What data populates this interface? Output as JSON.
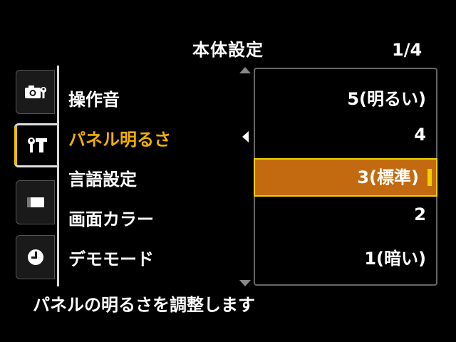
{
  "header": {
    "title": "本体設定",
    "page": "1/4"
  },
  "tabs": [
    {
      "icon": "camera-wrench-icon",
      "active": false
    },
    {
      "icon": "setup-wrench-icon",
      "active": true
    },
    {
      "icon": "card-icon",
      "active": false
    },
    {
      "icon": "clock-icon",
      "active": false
    }
  ],
  "menu": {
    "items": [
      {
        "label": "操作音"
      },
      {
        "label": "パネル明るさ"
      },
      {
        "label": "言語設定"
      },
      {
        "label": "画面カラー"
      },
      {
        "label": "デモモード"
      }
    ],
    "active_index": 1
  },
  "options": {
    "items": [
      {
        "label": "5(明るい)"
      },
      {
        "label": "4"
      },
      {
        "label": "3(標準)"
      },
      {
        "label": "2"
      },
      {
        "label": "1(暗い)"
      }
    ],
    "selected_index": 2
  },
  "colors": {
    "accent": "#f0b000",
    "highlight": "#c36a10",
    "highlight_border": "#f0d000"
  },
  "help_text": "パネルの明るさを調整します"
}
